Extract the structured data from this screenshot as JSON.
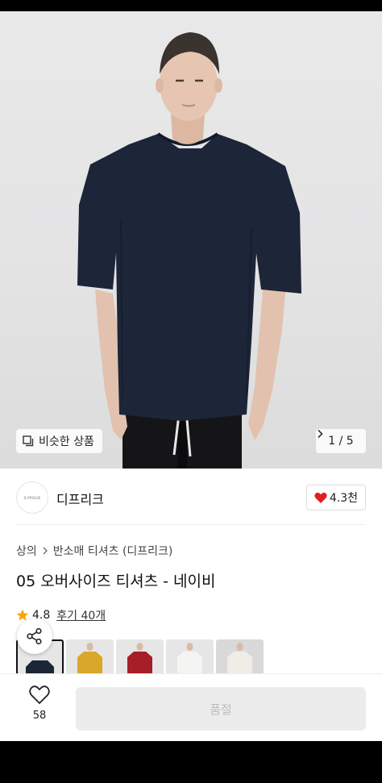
{
  "gallery": {
    "similar_label": "비슷한 상품",
    "counter": "1 / 5",
    "counter_icon": "chevron-right-icon"
  },
  "shop": {
    "logo_text": "D.PRIQUE",
    "name": "디프리크",
    "likes": "4.3천",
    "like_color": "#e02020"
  },
  "product": {
    "breadcrumb": [
      "상의",
      "반소매 티셔츠 (디프리크)"
    ],
    "title": "05 오버사이즈 티셔츠 - 네이비",
    "rating": "4.8",
    "review_label": "후기 40개",
    "star_color": "#f6a609",
    "color_options": [
      "navy",
      "yellow",
      "red",
      "white",
      "ivory"
    ]
  },
  "bottom": {
    "wish_count": "58",
    "cta_label": "품절"
  }
}
